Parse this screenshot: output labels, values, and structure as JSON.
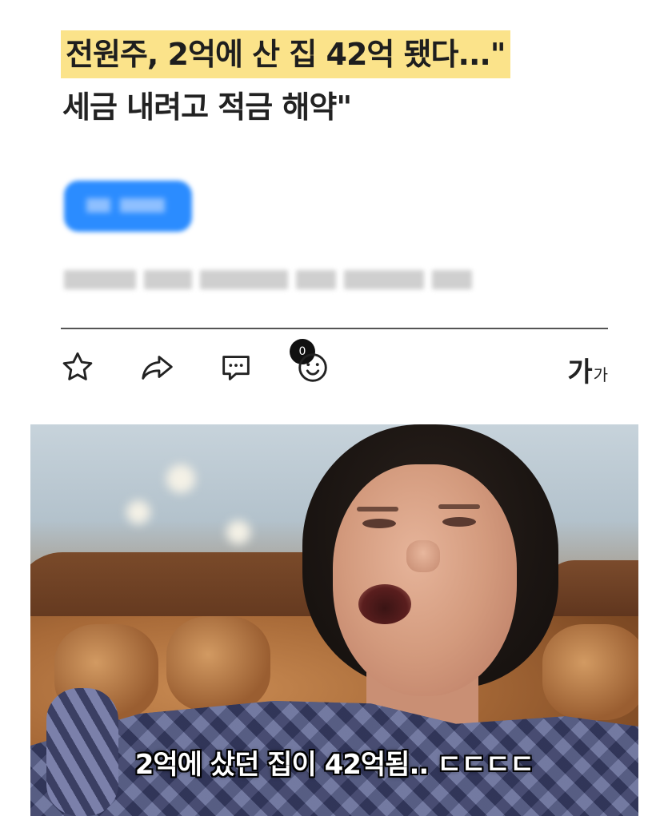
{
  "article": {
    "headline_line1": "전원주, 2억에 산 집 42억 됐다...\"",
    "headline_line2": "세금 내려고 적금 해약\"",
    "highlight_color": "#fbe38a"
  },
  "toolbar": {
    "bookmark_icon": "star-outline-icon",
    "share_icon": "share-arrow-icon",
    "comment_icon": "comment-icon",
    "comment_count": "0",
    "reaction_icon": "smiley-icon",
    "font_size_big": "가",
    "font_size_small": "가"
  },
  "image": {
    "subtitle": "2억에 샀던 집이 42억됨.. ㄷㄷㄷㄷ"
  }
}
